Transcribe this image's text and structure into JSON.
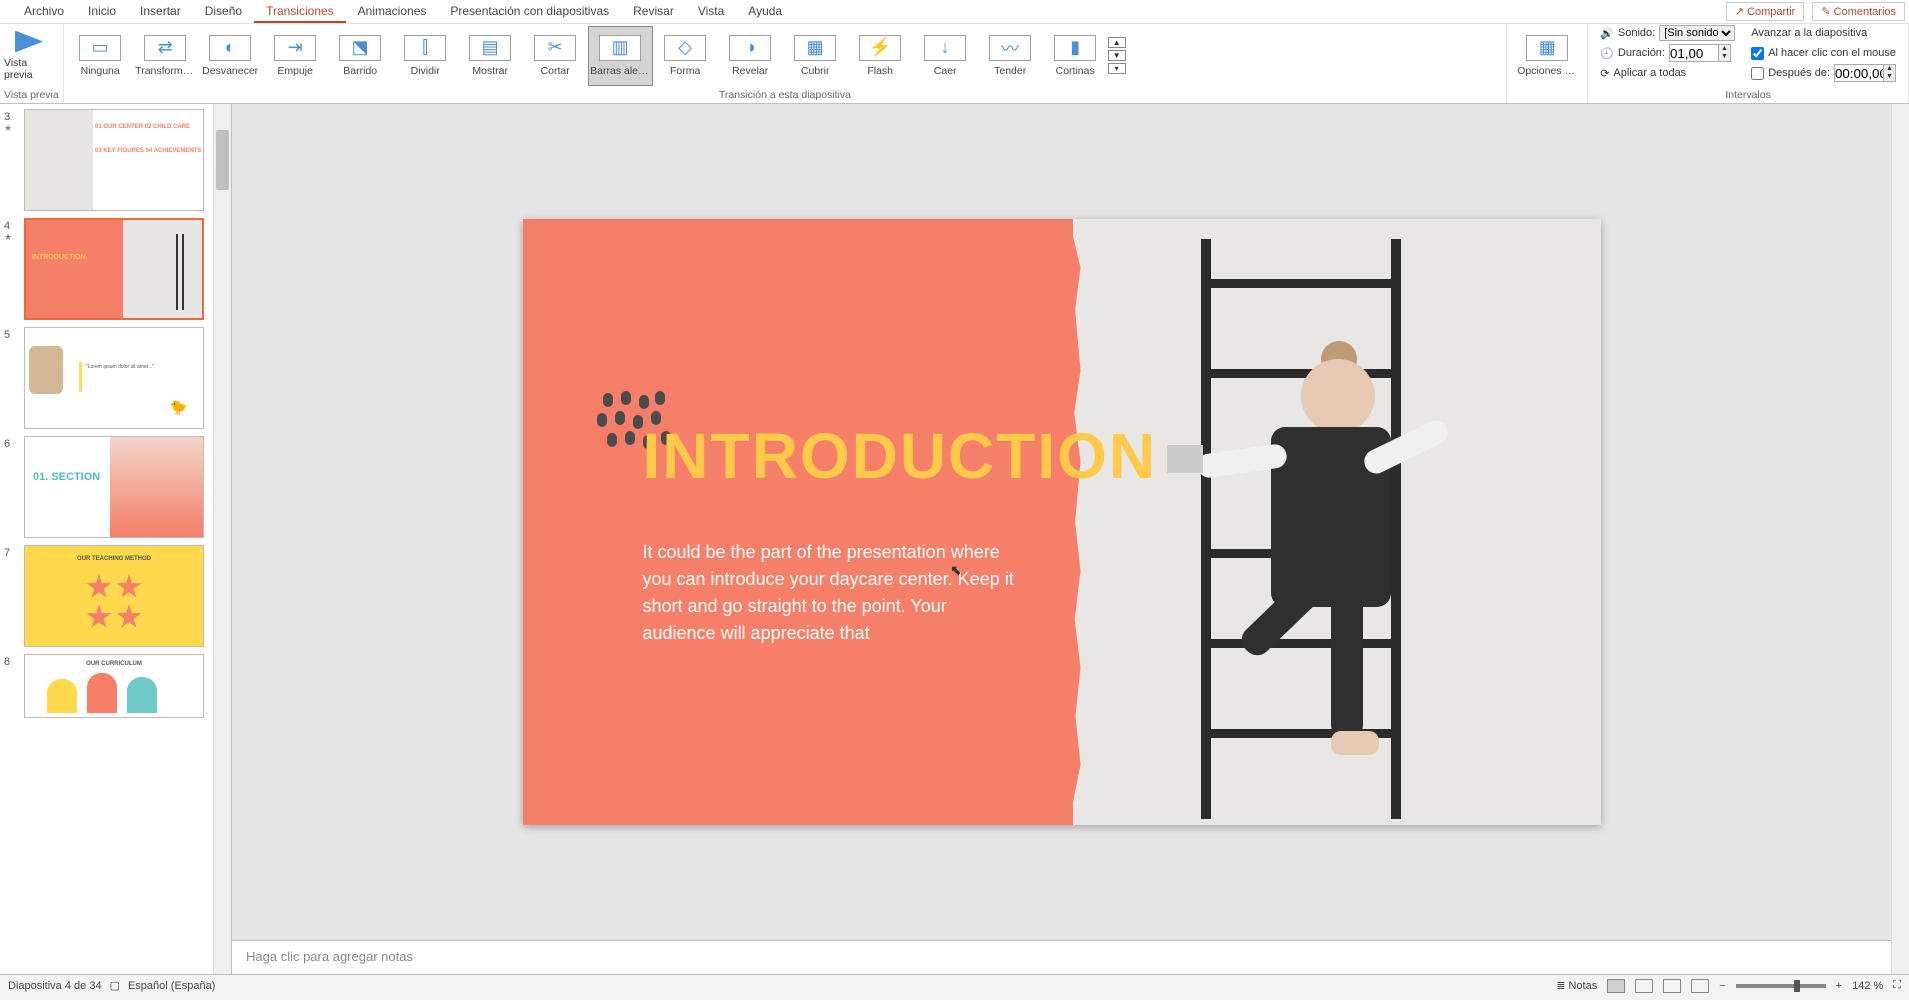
{
  "menu": {
    "items": [
      "Archivo",
      "Inicio",
      "Insertar",
      "Diseño",
      "Transiciones",
      "Animaciones",
      "Presentación con diapositivas",
      "Revisar",
      "Vista",
      "Ayuda"
    ],
    "active_index": 4,
    "compartir": "Compartir",
    "comentarios": "Comentarios"
  },
  "ribbon": {
    "preview_group_label": "Vista previa",
    "preview_btn": "Vista previa",
    "transitions_group_label": "Transición a esta diapositiva",
    "transitions": [
      "Ninguna",
      "Transforma...",
      "Desvanecer",
      "Empuje",
      "Barrido",
      "Dividir",
      "Mostrar",
      "Cortar",
      "Barras aleat...",
      "Forma",
      "Revelar",
      "Cubrir",
      "Flash",
      "Caer",
      "Tender",
      "Cortinas"
    ],
    "selected_transition_index": 8,
    "effect_options": "Opciones de efectos",
    "timing_group_label": "Intervalos",
    "sound_label": "Sonido:",
    "sound_value": "[Sin sonido]",
    "duration_label": "Duración:",
    "duration_value": "01,00",
    "apply_all": "Aplicar a todas",
    "advance_label": "Avanzar a la diapositiva",
    "on_click": "Al hacer clic con el mouse",
    "on_click_checked": true,
    "after_label": "Después de:",
    "after_value": "00:00,00",
    "after_checked": false
  },
  "thumbs": {
    "first_visible_index": 3,
    "active_slide": 4,
    "slides": [
      {
        "n": 3,
        "star": true
      },
      {
        "n": 4,
        "star": true
      },
      {
        "n": 5,
        "star": false
      },
      {
        "n": 6,
        "star": false
      },
      {
        "n": 7,
        "star": false
      },
      {
        "n": 8,
        "star": false
      }
    ],
    "thumb4_title": "INTRODUCTION",
    "thumb6_title": "01. SECTION",
    "thumb7_title": "OUR TEACHING METHOD",
    "thumb8_title": "OUR CURRICULUM"
  },
  "slide": {
    "title": "INTRODUCTION",
    "body": "It could be the part of the presentation where you can introduce your daycare center. Keep it short and go straight to the point. Your audience will appreciate that"
  },
  "notes_placeholder": "Haga clic para agregar notas",
  "status": {
    "slide_pos": "Diapositiva 4 de 34",
    "language": "Español (España)",
    "notes_btn": "Notas",
    "zoom": "142 %"
  }
}
